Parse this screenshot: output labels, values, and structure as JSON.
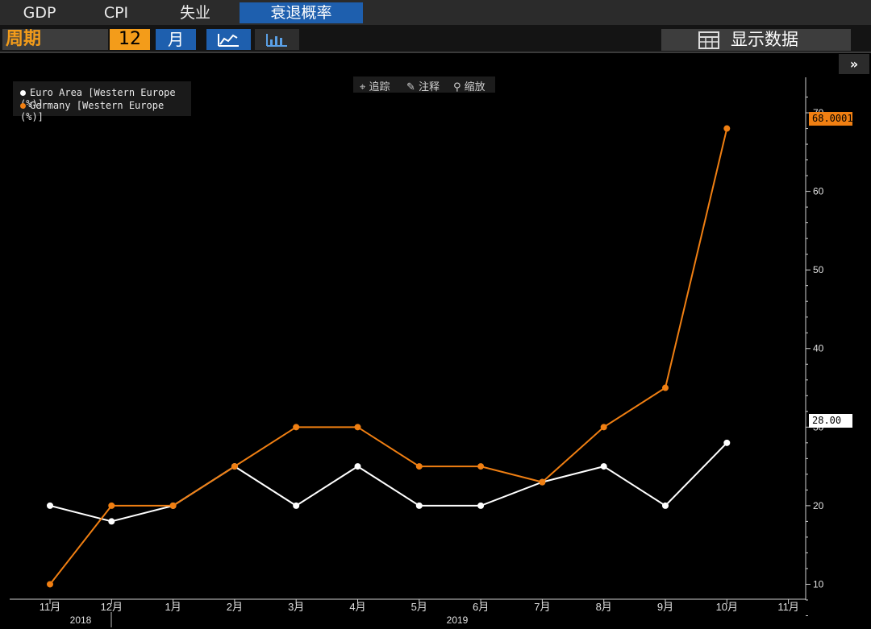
{
  "tabs": [
    "GDP",
    "CPI",
    "失业",
    "衰退概率"
  ],
  "toolbar": {
    "period_label": "周期",
    "period_value": "12",
    "period_unit": "月",
    "show_data_label": "显示数据",
    "more_label": "»"
  },
  "tools": [
    "追踪",
    "注释",
    "缩放"
  ],
  "colors": {
    "accent": "#f39c1a",
    "euro": "#ffffff",
    "germany": "#f07f12",
    "tab_active": "#1e5fae"
  },
  "chart_data": {
    "type": "line",
    "categories": [
      "11月",
      "12月",
      "1月",
      "2月",
      "3月",
      "4月",
      "5月",
      "6月",
      "7月",
      "8月",
      "9月",
      "10月",
      "11月"
    ],
    "year_labels": [
      "2018",
      "2019"
    ],
    "series": [
      {
        "name": "Euro Area [Western Europe (%)]",
        "color": "#ffffff",
        "values": [
          20,
          18,
          20,
          25,
          20,
          25,
          20,
          20,
          23,
          25,
          20,
          28,
          null
        ],
        "last_label": "28.00"
      },
      {
        "name": "Germany [Western Europe (%)]",
        "color": "#f07f12",
        "values": [
          10,
          20,
          20,
          25,
          30,
          30,
          25,
          25,
          23,
          30,
          35,
          68.0001,
          null
        ],
        "last_label": "68.0001"
      }
    ],
    "yticks": [
      10,
      20,
      30,
      40,
      50,
      60,
      70
    ],
    "ylim": [
      4,
      74
    ],
    "axis_side": "right",
    "legend_position": "top-left",
    "grid": false
  }
}
